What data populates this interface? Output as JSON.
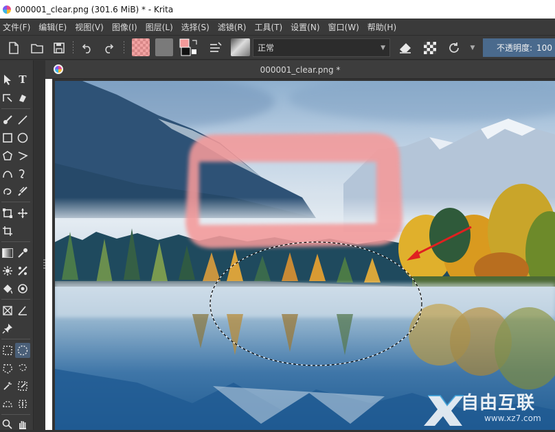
{
  "window": {
    "title": "000001_clear.png (301.6 MiB)  * - Krita"
  },
  "menu": [
    "文件(F)",
    "编辑(E)",
    "视图(V)",
    "图像(I)",
    "图层(L)",
    "选择(S)",
    "滤镜(R)",
    "工具(T)",
    "设置(N)",
    "窗口(W)",
    "帮助(H)"
  ],
  "toolbar": {
    "blend_mode": "正常",
    "opacity_label": "不透明度:",
    "opacity_value": "100"
  },
  "document": {
    "tab_title": "000001_clear.png *"
  },
  "watermark": {
    "letter": "X",
    "name": "自由互联",
    "url": "www.xz7.com"
  },
  "colors": {
    "accent_selection": "#4a6a8d",
    "brush_stroke": "#f59a9a",
    "arrow": "#e02020"
  }
}
